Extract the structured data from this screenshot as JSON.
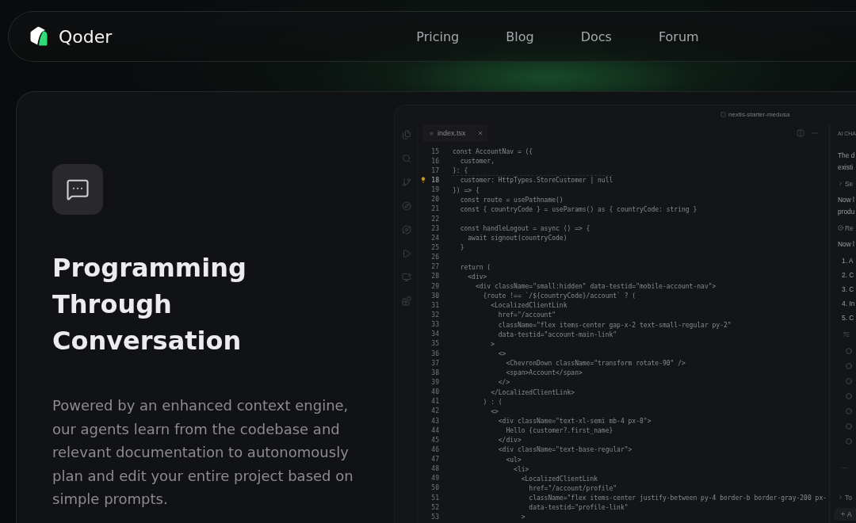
{
  "nav": {
    "brand": "Qoder",
    "links": [
      {
        "label": "Pricing"
      },
      {
        "label": "Blog"
      },
      {
        "label": "Docs"
      },
      {
        "label": "Forum"
      }
    ]
  },
  "feature": {
    "title": "Programming Through Conversation",
    "description": "Powered by an enhanced context engine, our agents learn from the codebase and relevant documentation to autonomously plan and edit your entire project based on simple prompts."
  },
  "editor": {
    "window_title": "nextis-starter-medusa",
    "tabs": [
      {
        "label": "index.tsx",
        "selected": true
      }
    ],
    "lines": [
      {
        "number": "15",
        "code": "const AccountNav = ({",
        "active": false
      },
      {
        "number": "16",
        "code": "  customer,",
        "active": false
      },
      {
        "number": "17",
        "code": "}: {",
        "active": false
      },
      {
        "number": "18",
        "code": "  customer: HttpTypes.StoreCustomer | null",
        "active": true
      },
      {
        "number": "19",
        "code": "}) => {",
        "active": false
      },
      {
        "number": "20",
        "code": "  const route = usePathname()",
        "active": false
      },
      {
        "number": "21",
        "code": "  const { countryCode } = useParams() as { countryCode: string }",
        "active": false
      },
      {
        "number": "22",
        "active": false
      },
      {
        "number": "23",
        "code": "  const handleLogout = async () => {",
        "active": false
      },
      {
        "number": "24",
        "code": "    await signout(countryCode)",
        "active": false
      },
      {
        "number": "25",
        "code": "  }",
        "active": false
      },
      {
        "number": "26",
        "active": false
      },
      {
        "number": "27",
        "code": "  return (",
        "active": false
      },
      {
        "number": "28",
        "code": "    <div>",
        "active": false
      },
      {
        "number": "29",
        "code": "      <div className=\"small:hidden\" data-testid=\"mobile-account-nav\">",
        "active": false
      },
      {
        "number": "30",
        "code": "        {route !== `/${countryCode}/account` ? (",
        "active": false
      },
      {
        "number": "31",
        "code": "          <LocalizedClientLink",
        "active": false
      },
      {
        "number": "32",
        "code": "            href=\"/account\"",
        "active": false
      },
      {
        "number": "33",
        "code": "            className=\"flex items-center gap-x-2 text-small-regular py-2\"",
        "active": false
      },
      {
        "number": "34",
        "code": "            data-testid=\"account-main-link\"",
        "active": false
      },
      {
        "number": "35",
        "code": "          >",
        "active": false
      },
      {
        "number": "36",
        "code": "            <>",
        "active": false
      },
      {
        "number": "37",
        "code": "              <ChevronDown className=\"transform rotate-90\" />",
        "active": false
      },
      {
        "number": "38",
        "code": "              <span>Account</span>",
        "active": false
      },
      {
        "number": "39",
        "code": "            </>",
        "active": false
      },
      {
        "number": "40",
        "code": "          </LocalizedClientLink>",
        "active": false
      },
      {
        "number": "41",
        "code": "        ) : (",
        "active": false
      },
      {
        "number": "42",
        "code": "          <>",
        "active": false
      },
      {
        "number": "43",
        "code": "            <div className=\"text-xl-semi mb-4 px-8\">",
        "active": false
      },
      {
        "number": "44",
        "code": "              Hello {customer?.first_name}",
        "active": false
      },
      {
        "number": "45",
        "code": "            </div>",
        "active": false
      },
      {
        "number": "46",
        "code": "            <div className=\"text-base-regular\">",
        "active": false
      },
      {
        "number": "47",
        "code": "              <ul>",
        "active": false
      },
      {
        "number": "48",
        "code": "                <li>",
        "active": false
      },
      {
        "number": "49",
        "code": "                  <LocalizedClientLink",
        "active": false
      },
      {
        "number": "50",
        "code": "                    href=\"/account/profile\"",
        "active": false
      },
      {
        "number": "51",
        "code": "                    className=\"flex items-center justify-between py-4 border-b border-gray-200 px-",
        "active": false
      },
      {
        "number": "52",
        "code": "                    data-testid=\"profile-link\"",
        "active": false
      },
      {
        "number": "53",
        "code": "                  >",
        "active": false
      }
    ]
  },
  "chat": {
    "title": "AI CHA",
    "items": [
      {
        "kind": "text",
        "text": "The d"
      },
      {
        "kind": "text",
        "text": "existi"
      },
      {
        "kind": "step",
        "text": "Se"
      },
      {
        "kind": "text",
        "text": "Now l"
      },
      {
        "kind": "text",
        "text": "produ"
      },
      {
        "kind": "tool",
        "text": "Re"
      },
      {
        "kind": "text",
        "text": "Now l"
      },
      {
        "kind": "numbered",
        "text": "1. A"
      },
      {
        "kind": "numbered",
        "text": "2. C"
      },
      {
        "kind": "numbered",
        "text": "3. C"
      },
      {
        "kind": "numbered",
        "text": "4. In"
      },
      {
        "kind": "numbered",
        "text": "5. C"
      },
      {
        "kind": "list"
      },
      {
        "kind": "todo",
        "checked": false
      },
      {
        "kind": "todo",
        "checked": false
      },
      {
        "kind": "todo",
        "checked": false
      },
      {
        "kind": "todo",
        "checked": false
      },
      {
        "kind": "todo",
        "checked": false
      },
      {
        "kind": "todo",
        "checked": false
      },
      {
        "kind": "todo",
        "checked": false
      },
      {
        "kind": "more"
      },
      {
        "kind": "step",
        "text": "To"
      }
    ],
    "input": {
      "text": "A"
    }
  }
}
